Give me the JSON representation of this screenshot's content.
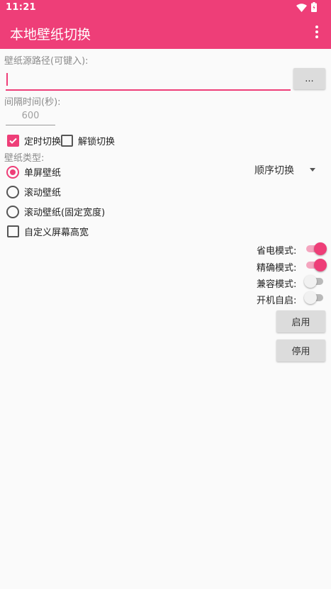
{
  "status_bar": {
    "time": "11:21",
    "wifi_icon": "wifi-icon",
    "battery_icon": "battery-icon"
  },
  "app_bar": {
    "title": "本地壁纸切换",
    "menu_icon": "more-vert-icon"
  },
  "wallpaper_path": {
    "label": "壁纸源路径(可键入):",
    "value": "",
    "browse_label": "..."
  },
  "interval": {
    "label": "间隔时间(秒):",
    "placeholder": "600"
  },
  "timed_switch": {
    "label": "定时切换",
    "checked": true
  },
  "unlock_switch": {
    "label": "解锁切换",
    "checked": false
  },
  "wallpaper_type": {
    "label": "壁纸类型:",
    "options": [
      {
        "label": "单屏壁纸",
        "selected": true
      },
      {
        "label": "滚动壁纸",
        "selected": false
      },
      {
        "label": "滚动壁纸(固定宽度)",
        "selected": false
      }
    ]
  },
  "order_spinner": {
    "value": "顺序切换"
  },
  "custom_screen": {
    "label": "自定义屏幕高宽",
    "checked": false
  },
  "toggles": [
    {
      "label": "省电模式:",
      "on": true
    },
    {
      "label": "精确模式:",
      "on": true
    },
    {
      "label": "兼容模式:",
      "on": false
    },
    {
      "label": "开机自启:",
      "on": false
    }
  ],
  "buttons": {
    "enable": "启用",
    "disable": "停用"
  },
  "colors": {
    "accent": "#ee3e78",
    "accent_light": "#f4a5bf",
    "button_bg": "#dcdcdc",
    "background": "#fafafa"
  }
}
